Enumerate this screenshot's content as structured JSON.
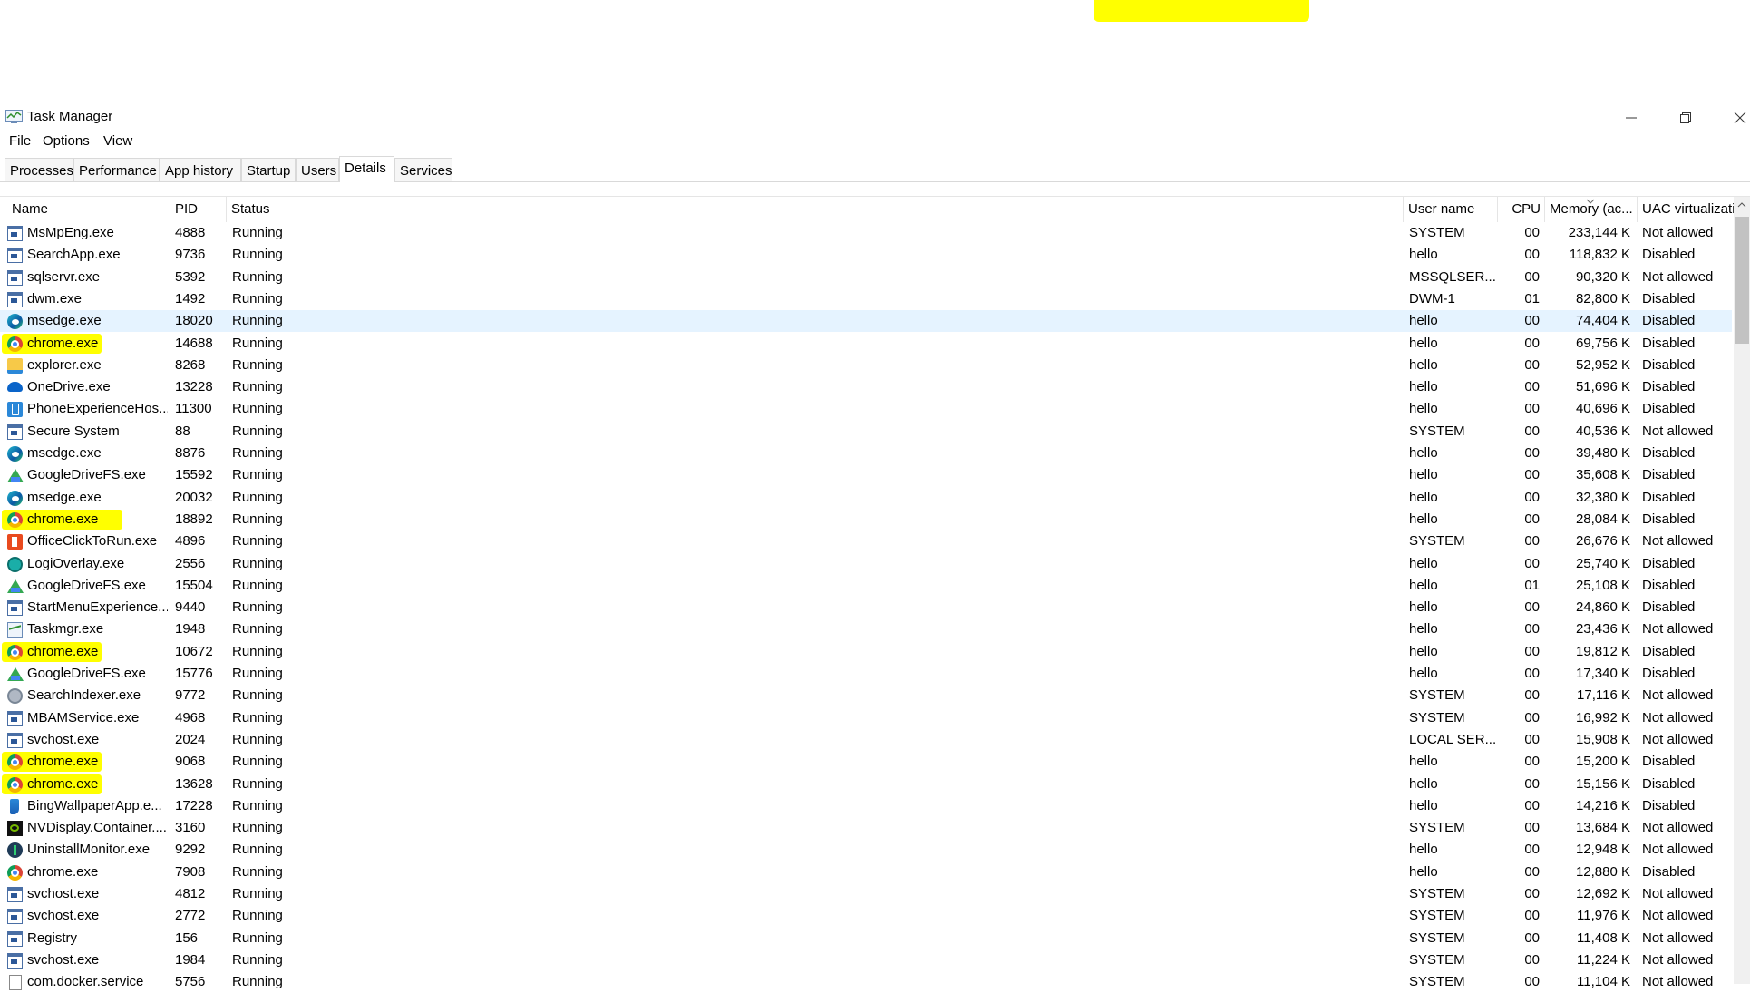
{
  "window": {
    "title": "Task Manager"
  },
  "menu": [
    "File",
    "Options",
    "View"
  ],
  "tabs": [
    "Processes",
    "Performance",
    "App history",
    "Startup",
    "Users",
    "Details",
    "Services"
  ],
  "active_tab": "Details",
  "columns": {
    "name": "Name",
    "pid": "PID",
    "status": "Status",
    "user": "User name",
    "cpu": "CPU",
    "memory": "Memory (ac...",
    "uac": "UAC virtualizati..."
  },
  "rows": [
    {
      "name": "MsMpEng.exe",
      "icon": "exe-icon",
      "pid": "4888",
      "status": "Running",
      "user": "SYSTEM",
      "cpu": "00",
      "memory": "233,144 K",
      "uac": "Not allowed"
    },
    {
      "name": "SearchApp.exe",
      "icon": "exe-icon",
      "pid": "9736",
      "status": "Running",
      "user": "hello",
      "cpu": "00",
      "memory": "118,832 K",
      "uac": "Disabled"
    },
    {
      "name": "sqlservr.exe",
      "icon": "exe-icon",
      "pid": "5392",
      "status": "Running",
      "user": "MSSQLSER...",
      "cpu": "00",
      "memory": "90,320 K",
      "uac": "Not allowed"
    },
    {
      "name": "dwm.exe",
      "icon": "exe-icon",
      "pid": "1492",
      "status": "Running",
      "user": "DWM-1",
      "cpu": "01",
      "memory": "82,800 K",
      "uac": "Disabled"
    },
    {
      "name": "msedge.exe",
      "icon": "edge-icon",
      "pid": "18020",
      "status": "Running",
      "user": "hello",
      "cpu": "00",
      "memory": "74,404 K",
      "uac": "Disabled",
      "selected": true
    },
    {
      "name": "chrome.exe",
      "icon": "chrome-icon",
      "pid": "14688",
      "status": "Running",
      "user": "hello",
      "cpu": "00",
      "memory": "69,756 K",
      "uac": "Disabled",
      "highlight": true
    },
    {
      "name": "explorer.exe",
      "icon": "explorer-icon",
      "pid": "8268",
      "status": "Running",
      "user": "hello",
      "cpu": "00",
      "memory": "52,952 K",
      "uac": "Disabled"
    },
    {
      "name": "OneDrive.exe",
      "icon": "onedrive-icon",
      "pid": "13228",
      "status": "Running",
      "user": "hello",
      "cpu": "00",
      "memory": "51,696 K",
      "uac": "Disabled"
    },
    {
      "name": "PhoneExperienceHos...",
      "icon": "phone-icon",
      "pid": "11300",
      "status": "Running",
      "user": "hello",
      "cpu": "00",
      "memory": "40,696 K",
      "uac": "Disabled"
    },
    {
      "name": "Secure System",
      "icon": "exe-icon",
      "pid": "88",
      "status": "Running",
      "user": "SYSTEM",
      "cpu": "00",
      "memory": "40,536 K",
      "uac": "Not allowed"
    },
    {
      "name": "msedge.exe",
      "icon": "edge-icon",
      "pid": "8876",
      "status": "Running",
      "user": "hello",
      "cpu": "00",
      "memory": "39,480 K",
      "uac": "Disabled"
    },
    {
      "name": "GoogleDriveFS.exe",
      "icon": "drive-icon",
      "pid": "15592",
      "status": "Running",
      "user": "hello",
      "cpu": "00",
      "memory": "35,608 K",
      "uac": "Disabled"
    },
    {
      "name": "msedge.exe",
      "icon": "edge-icon",
      "pid": "20032",
      "status": "Running",
      "user": "hello",
      "cpu": "00",
      "memory": "32,380 K",
      "uac": "Disabled"
    },
    {
      "name": "chrome.exe",
      "icon": "chrome-icon",
      "pid": "18892",
      "status": "Running",
      "user": "hello",
      "cpu": "00",
      "memory": "28,084 K",
      "uac": "Disabled",
      "highlight": true
    },
    {
      "name": "OfficeClickToRun.exe",
      "icon": "office-icon",
      "pid": "4896",
      "status": "Running",
      "user": "SYSTEM",
      "cpu": "00",
      "memory": "26,676 K",
      "uac": "Not allowed"
    },
    {
      "name": "LogiOverlay.exe",
      "icon": "logi-icon",
      "pid": "2556",
      "status": "Running",
      "user": "hello",
      "cpu": "00",
      "memory": "25,740 K",
      "uac": "Disabled"
    },
    {
      "name": "GoogleDriveFS.exe",
      "icon": "drive-icon",
      "pid": "15504",
      "status": "Running",
      "user": "hello",
      "cpu": "01",
      "memory": "25,108 K",
      "uac": "Disabled"
    },
    {
      "name": "StartMenuExperience...",
      "icon": "exe-icon",
      "pid": "9440",
      "status": "Running",
      "user": "hello",
      "cpu": "00",
      "memory": "24,860 K",
      "uac": "Disabled"
    },
    {
      "name": "Taskmgr.exe",
      "icon": "taskmgr-icon",
      "pid": "1948",
      "status": "Running",
      "user": "hello",
      "cpu": "00",
      "memory": "23,436 K",
      "uac": "Not allowed"
    },
    {
      "name": "chrome.exe",
      "icon": "chrome-icon",
      "pid": "10672",
      "status": "Running",
      "user": "hello",
      "cpu": "00",
      "memory": "19,812 K",
      "uac": "Disabled",
      "highlight": true
    },
    {
      "name": "GoogleDriveFS.exe",
      "icon": "drive-icon",
      "pid": "15776",
      "status": "Running",
      "user": "hello",
      "cpu": "00",
      "memory": "17,340 K",
      "uac": "Disabled"
    },
    {
      "name": "SearchIndexer.exe",
      "icon": "search-indexer-icon",
      "pid": "9772",
      "status": "Running",
      "user": "SYSTEM",
      "cpu": "00",
      "memory": "17,116 K",
      "uac": "Not allowed"
    },
    {
      "name": "MBAMService.exe",
      "icon": "exe-icon",
      "pid": "4968",
      "status": "Running",
      "user": "SYSTEM",
      "cpu": "00",
      "memory": "16,992 K",
      "uac": "Not allowed"
    },
    {
      "name": "svchost.exe",
      "icon": "exe-icon",
      "pid": "2024",
      "status": "Running",
      "user": "LOCAL SER...",
      "cpu": "00",
      "memory": "15,908 K",
      "uac": "Not allowed"
    },
    {
      "name": "chrome.exe",
      "icon": "chrome-icon",
      "pid": "9068",
      "status": "Running",
      "user": "hello",
      "cpu": "00",
      "memory": "15,200 K",
      "uac": "Disabled",
      "highlight": true
    },
    {
      "name": "chrome.exe",
      "icon": "chrome-icon",
      "pid": "13628",
      "status": "Running",
      "user": "hello",
      "cpu": "00",
      "memory": "15,156 K",
      "uac": "Disabled",
      "highlight": true
    },
    {
      "name": "BingWallpaperApp.e...",
      "icon": "bing-icon",
      "pid": "17228",
      "status": "Running",
      "user": "hello",
      "cpu": "00",
      "memory": "14,216 K",
      "uac": "Disabled"
    },
    {
      "name": "NVDisplay.Container....",
      "icon": "nvidia-icon",
      "pid": "3160",
      "status": "Running",
      "user": "SYSTEM",
      "cpu": "00",
      "memory": "13,684 K",
      "uac": "Not allowed"
    },
    {
      "name": "UninstallMonitor.exe",
      "icon": "uninstall-icon",
      "pid": "9292",
      "status": "Running",
      "user": "hello",
      "cpu": "00",
      "memory": "12,948 K",
      "uac": "Not allowed"
    },
    {
      "name": "chrome.exe",
      "icon": "chrome-icon",
      "pid": "7908",
      "status": "Running",
      "user": "hello",
      "cpu": "00",
      "memory": "12,880 K",
      "uac": "Disabled"
    },
    {
      "name": "svchost.exe",
      "icon": "exe-icon",
      "pid": "4812",
      "status": "Running",
      "user": "SYSTEM",
      "cpu": "00",
      "memory": "12,692 K",
      "uac": "Not allowed"
    },
    {
      "name": "svchost.exe",
      "icon": "exe-icon",
      "pid": "2772",
      "status": "Running",
      "user": "SYSTEM",
      "cpu": "00",
      "memory": "11,976 K",
      "uac": "Not allowed"
    },
    {
      "name": "Registry",
      "icon": "exe-icon",
      "pid": "156",
      "status": "Running",
      "user": "SYSTEM",
      "cpu": "00",
      "memory": "11,408 K",
      "uac": "Not allowed"
    },
    {
      "name": "svchost.exe",
      "icon": "exe-icon",
      "pid": "1984",
      "status": "Running",
      "user": "SYSTEM",
      "cpu": "00",
      "memory": "11,224 K",
      "uac": "Not allowed"
    },
    {
      "name": "com.docker.service",
      "icon": "file-icon",
      "pid": "5756",
      "status": "Running",
      "user": "SYSTEM",
      "cpu": "00",
      "memory": "11,104 K",
      "uac": "Not allowed"
    }
  ],
  "colors": {
    "highlight": "#ffff00",
    "selected_row": "#e5f3ff",
    "tab_border": "#d9d9d9"
  }
}
